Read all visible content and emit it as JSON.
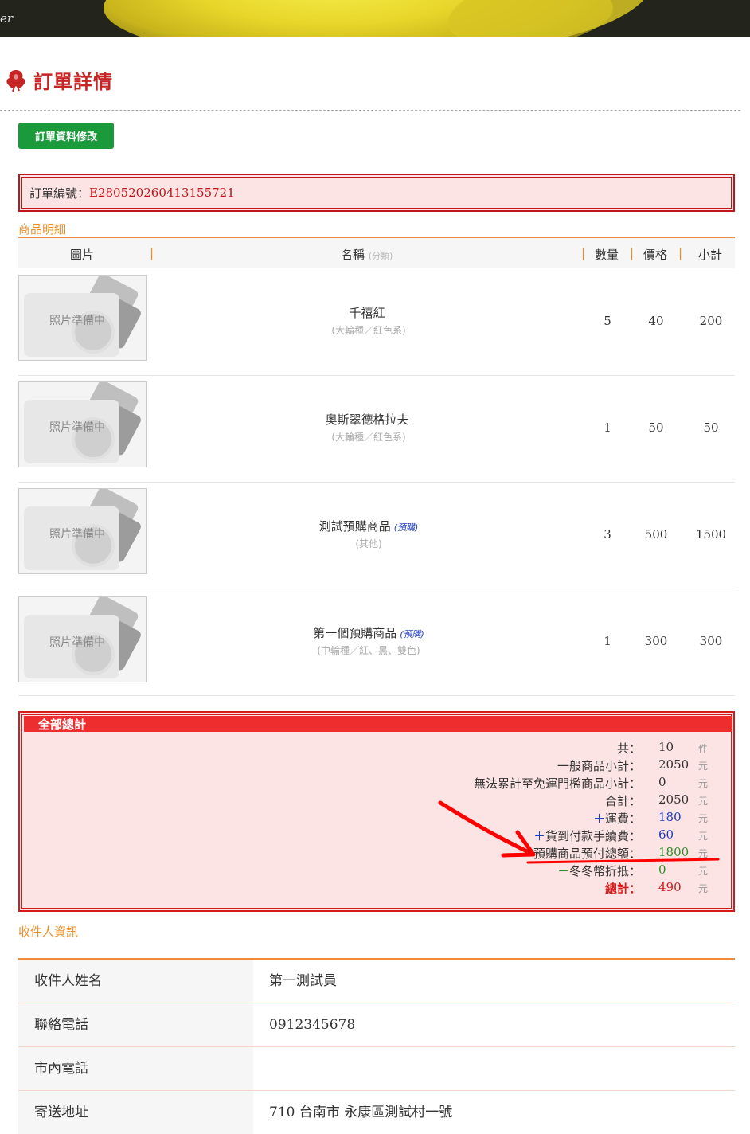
{
  "banner": {
    "text": "er"
  },
  "page": {
    "title": "訂單詳情"
  },
  "actions": {
    "edit_label": "訂單資料修改"
  },
  "order": {
    "label": "訂單編號：",
    "number": "E280520260413155721"
  },
  "products": {
    "section_label": "商品明細",
    "headers": {
      "image": "圖片",
      "name": "名稱",
      "category_hint": "(分類)",
      "qty": "數量",
      "price": "價格",
      "subtotal": "小計"
    },
    "placeholder_text": "照片準備中",
    "items": [
      {
        "name": "千禧紅",
        "tag": "",
        "category": "(大輪種／紅色系)",
        "qty": "5",
        "price": "40",
        "subtotal": "200"
      },
      {
        "name": "奧斯翠德格拉夫",
        "tag": "",
        "category": "(大輪種／紅色系)",
        "qty": "1",
        "price": "50",
        "subtotal": "50"
      },
      {
        "name": "測試預購商品",
        "tag": "(預購)",
        "category": "(其他)",
        "qty": "3",
        "price": "500",
        "subtotal": "1500"
      },
      {
        "name": "第一個預購商品",
        "tag": "(預購)",
        "category": "(中輪種／紅、黑、雙色)",
        "qty": "1",
        "price": "300",
        "subtotal": "300"
      }
    ]
  },
  "totals": {
    "header": "全部總計",
    "lines": [
      {
        "label": "共：",
        "value": "10",
        "unit": "件",
        "style": ""
      },
      {
        "label": "一般商品小計：",
        "value": "2050",
        "unit": "元",
        "style": ""
      },
      {
        "label": "無法累計至免運門檻商品小計：",
        "value": "0",
        "unit": "元",
        "style": ""
      },
      {
        "label": "合計：",
        "value": "2050",
        "unit": "元",
        "style": ""
      },
      {
        "sign": "＋",
        "label": "運費：",
        "value": "180",
        "unit": "元",
        "style": "blue"
      },
      {
        "sign": "＋",
        "label": "貨到付款手續費：",
        "value": "60",
        "unit": "元",
        "style": "blue"
      },
      {
        "sign": "－",
        "label": "預購商品預付總額：",
        "value": "1800",
        "unit": "元",
        "style": "green"
      },
      {
        "sign": "－",
        "label": "冬冬幣折抵：",
        "value": "0",
        "unit": "元",
        "style": "green"
      },
      {
        "label": "總計：",
        "value": "490",
        "unit": "元",
        "style": "red"
      }
    ]
  },
  "recipient": {
    "section_label": "收件人資訊",
    "rows": [
      {
        "key": "收件人姓名",
        "value": "第一測試員"
      },
      {
        "key": "聯絡電話",
        "value": "0912345678"
      },
      {
        "key": "市內電話",
        "value": ""
      },
      {
        "key": "寄送地址",
        "value": "710 台南市 永康區測試村一號"
      }
    ]
  },
  "colors": {
    "accent": "#c62424",
    "button": "#1b9a3b",
    "orange": "#e8902a",
    "annotation": "#ff0000"
  }
}
